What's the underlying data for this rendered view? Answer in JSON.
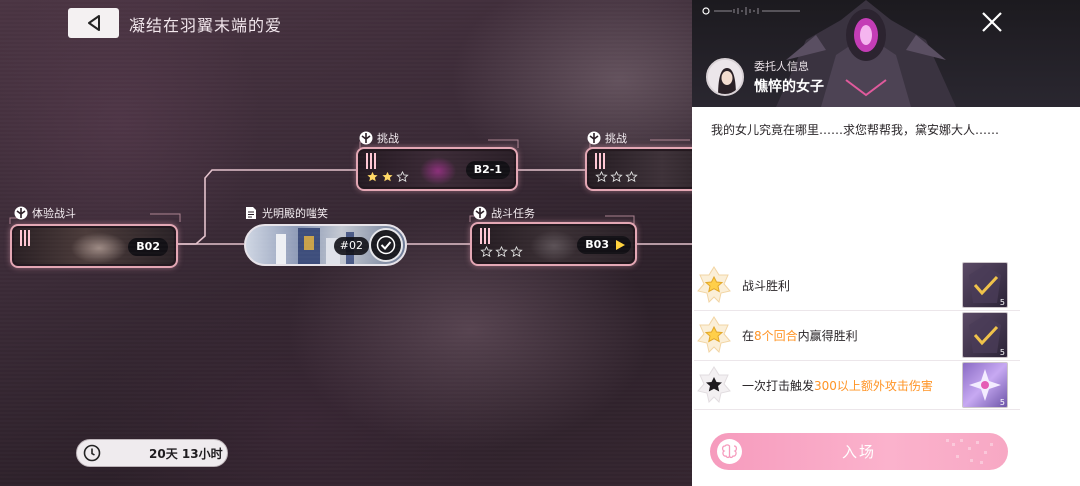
{
  "header": {
    "title": "凝结在羽翼末端的爱"
  },
  "nodes": {
    "battle_trial": {
      "type": "体验战斗",
      "code": "B02"
    },
    "story": {
      "type": "光明殿的嗤笑",
      "code": "#02"
    },
    "challenge_1": {
      "type": "挑战",
      "code": "B2-1",
      "stars": 2
    },
    "challenge_2": {
      "type": "挑战",
      "stars": 0
    },
    "battle_mission": {
      "type": "战斗任务",
      "code": "B03",
      "stars": 0
    }
  },
  "timer": {
    "text": "20天 13小时"
  },
  "panel": {
    "client_label": "委托人信息",
    "client_name": "憔悴的女子",
    "description": "我的女儿究竟在哪里……求您帮帮我，黛安娜大人……",
    "goals": [
      {
        "pre": "战斗胜利",
        "hl": "",
        "post": "",
        "reward_count": "5",
        "badge": "gold"
      },
      {
        "pre": "在",
        "hl": "8个回合",
        "post": "内赢得胜利",
        "reward_count": "5",
        "badge": "gold"
      },
      {
        "pre": "一次打击触发",
        "hl": "300以上额外攻击伤害",
        "post": "",
        "reward_count": "5",
        "badge": "dark"
      }
    ],
    "enter_label": "入场"
  },
  "colors": {
    "accent": "#ff9426",
    "enter_button": "#f7a8c4",
    "node_border": "#e4a7b4"
  }
}
